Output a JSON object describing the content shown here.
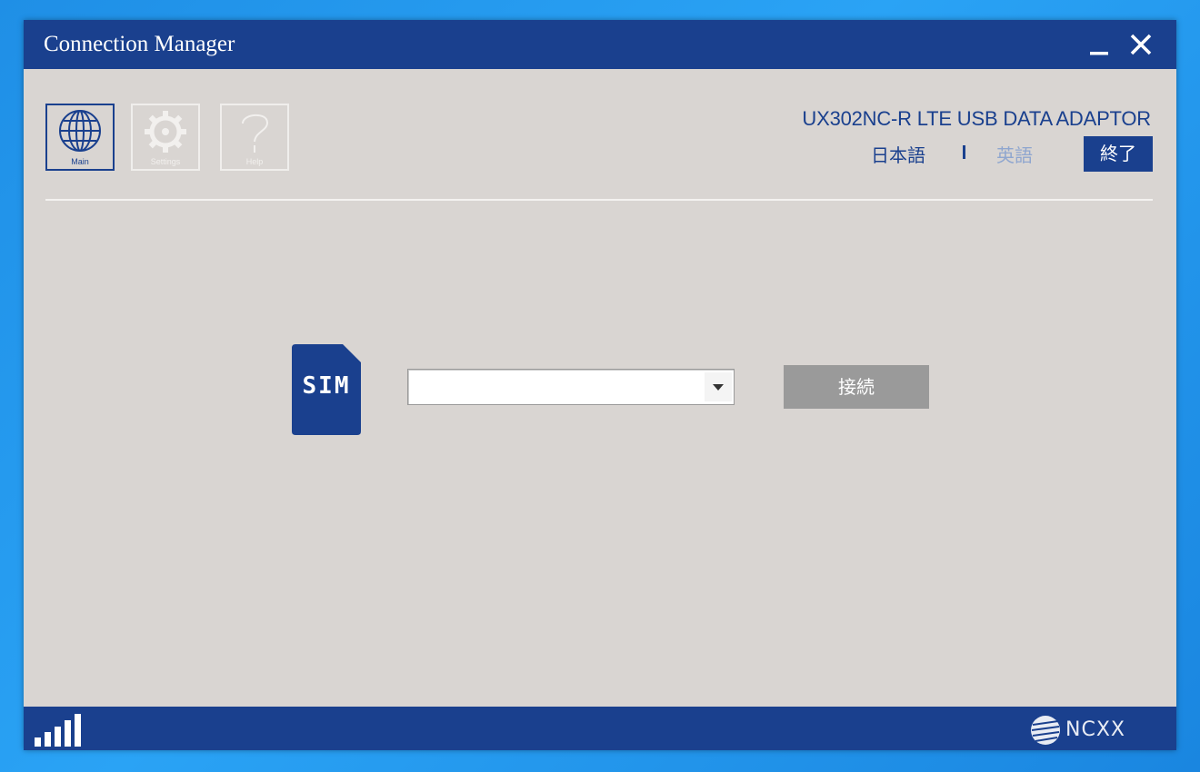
{
  "window": {
    "title": "Connection Manager"
  },
  "nav": {
    "main_label": "Main",
    "settings_label": "Settings",
    "help_label": "Help"
  },
  "header": {
    "product_name": "UX302NC-R LTE USB DATA ADAPTOR",
    "lang_japanese": "日本語",
    "lang_english": "英語",
    "exit_label": "終了"
  },
  "sim": {
    "icon_label": "SIM",
    "selected_value": "",
    "connect_label": "接続"
  },
  "statusbar": {
    "brand": "NCXX"
  },
  "colors": {
    "brand_blue": "#1a408e",
    "panel_bg": "#d9d5d2",
    "button_gray": "#9a9a9a",
    "inactive_lang": "#8fa6cf"
  }
}
